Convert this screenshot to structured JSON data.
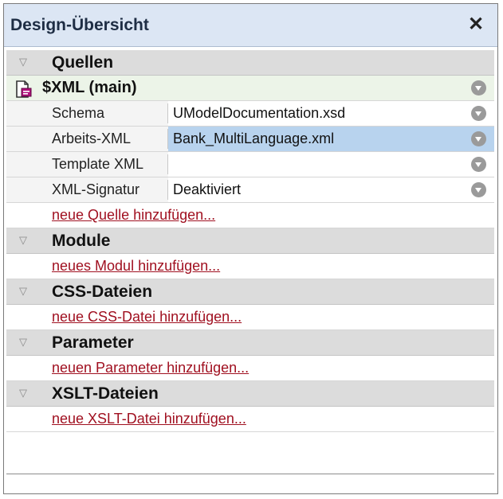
{
  "window": {
    "title": "Design-Übersicht",
    "close_icon": "close-icon",
    "close_glyph": "✕"
  },
  "sections": {
    "sources": {
      "label": "Quellen"
    },
    "modules": {
      "label": "Module"
    },
    "css": {
      "label": "CSS-Dateien"
    },
    "params": {
      "label": "Parameter"
    },
    "xslt": {
      "label": "XSLT-Dateien"
    }
  },
  "source": {
    "label": "$XML (main)",
    "icon": "xml-document-icon",
    "properties": [
      {
        "key": "Schema",
        "value": "UModelDocumentation.xsd"
      },
      {
        "key": "Arbeits-XML",
        "value": "Bank_MultiLanguage.xml"
      },
      {
        "key": "Template XML",
        "value": ""
      },
      {
        "key": "XML-Signatur",
        "value": "Deaktiviert"
      }
    ]
  },
  "links": {
    "add_source": "neue Quelle hinzufügen...",
    "add_module": "neues Modul hinzufügen...",
    "add_css": "neue CSS-Datei hinzufügen...",
    "add_param": "neuen Parameter hinzufügen...",
    "add_xslt": "neue XSLT-Datei hinzufügen..."
  },
  "colors": {
    "title_bg": "#dce6f4",
    "section_bg": "#dcdcdc",
    "main_row_bg": "#ecf4e8",
    "selected_bg": "#b8d3ee",
    "link": "#a01020"
  }
}
